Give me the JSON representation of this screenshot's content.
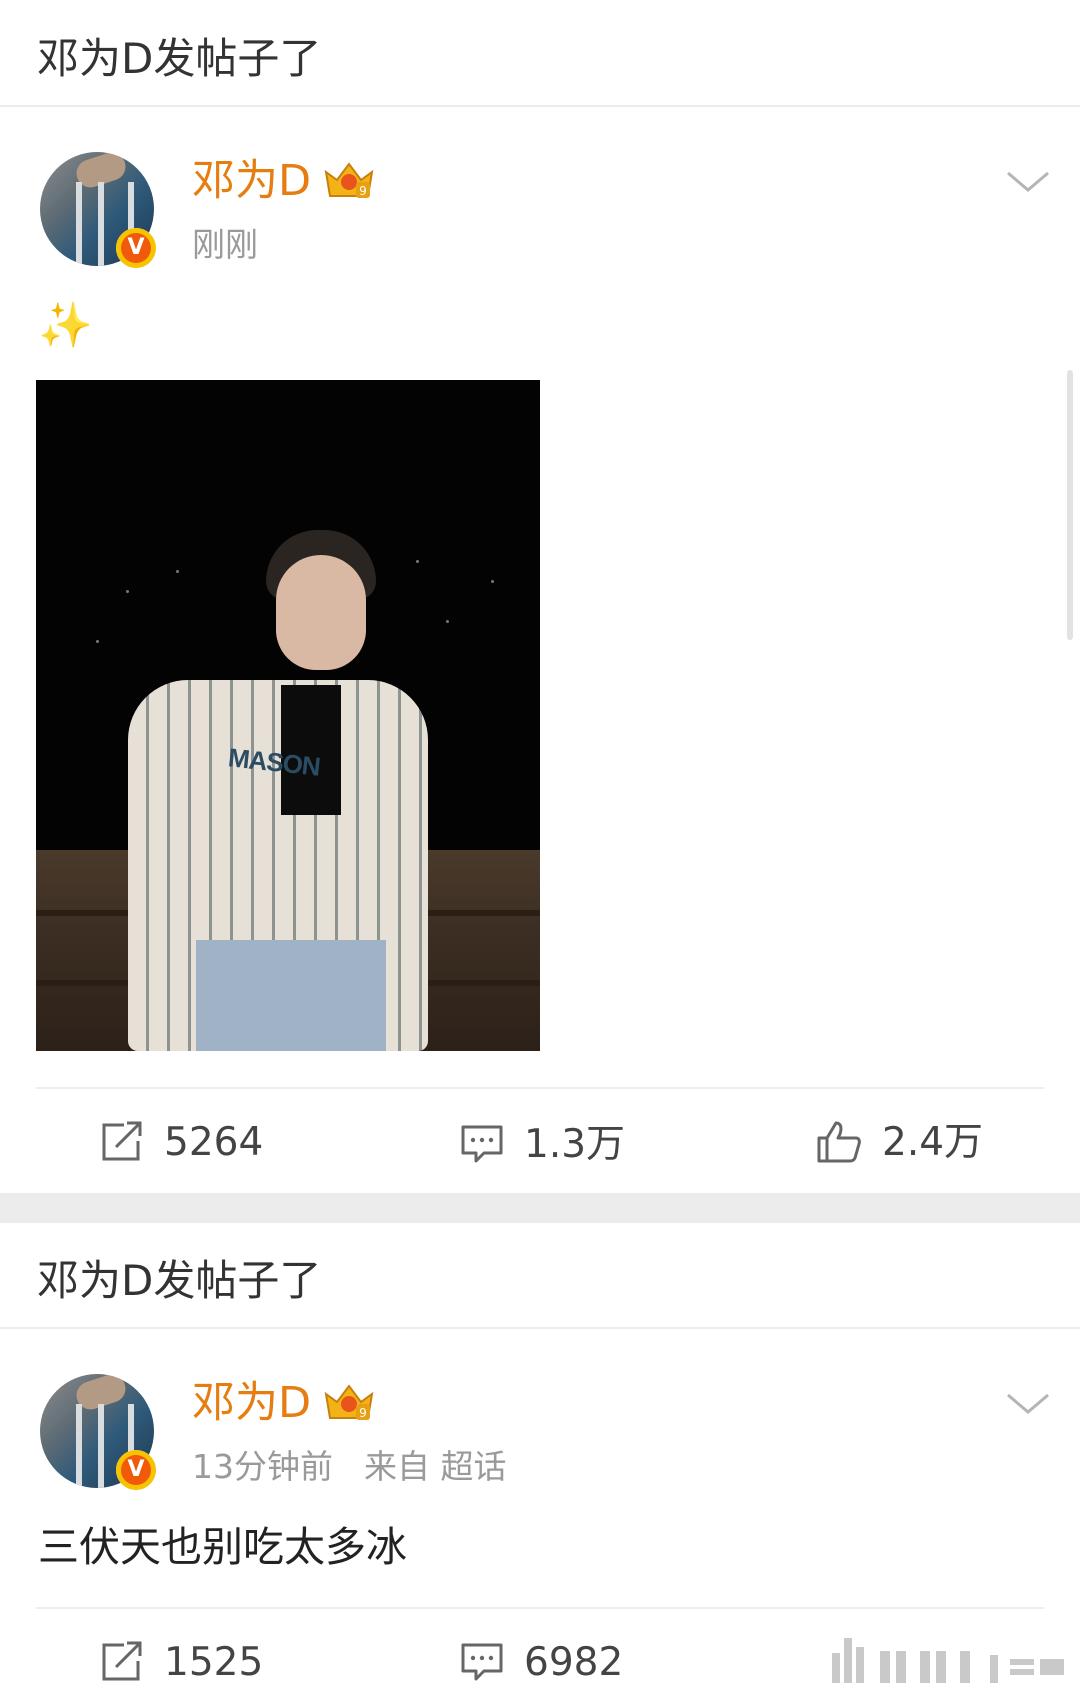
{
  "feed": [
    {
      "section_title": "邓为D发帖子了",
      "author": "邓为D",
      "timestamp": "刚刚",
      "source": "",
      "text": "✨",
      "has_image": true,
      "image_text": "MASON",
      "actions": {
        "repost": "5264",
        "comment": "1.3万",
        "like": "2.4万"
      }
    },
    {
      "section_title": "邓为D发帖子了",
      "author": "邓为D",
      "timestamp": "13分钟前",
      "source": "来自 超话",
      "text": "三伏天也别吃太多冰",
      "has_image": false,
      "actions": {
        "repost": "1525",
        "comment": "6982"
      }
    }
  ],
  "icons": {
    "verified_badge": "verified-v-badge-icon",
    "crown": "vip-crown-icon",
    "dropdown": "chevron-down-icon",
    "repost": "repost-icon",
    "comment": "comment-icon",
    "like": "thumbs-up-icon"
  },
  "colors": {
    "username": "#e67d11",
    "badge": "#f05a0a",
    "text": "#333333",
    "meta": "#9a9a9a",
    "divider": "#ececec"
  }
}
